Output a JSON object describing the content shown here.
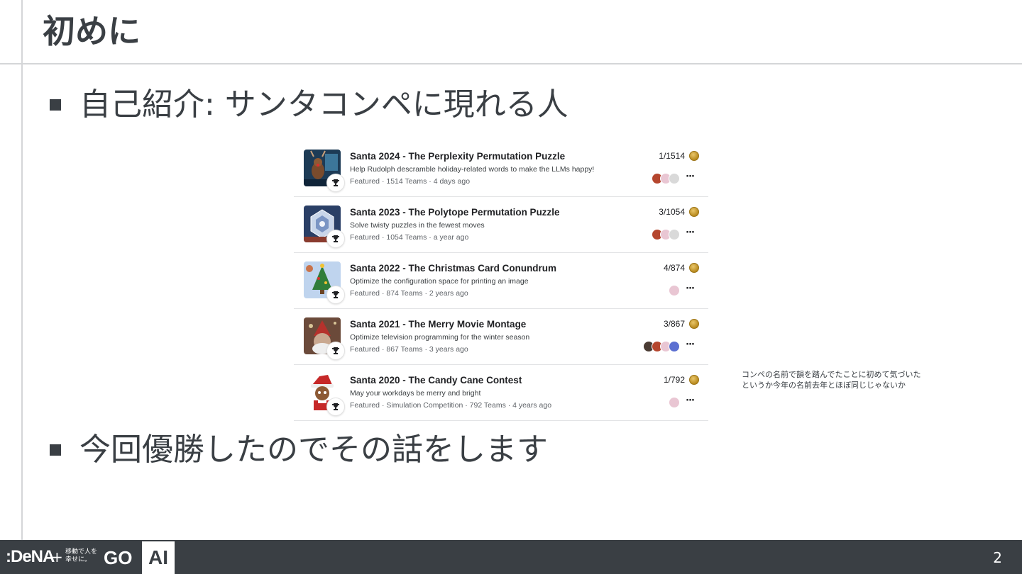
{
  "slide": {
    "title": "初めに",
    "bullets": [
      "自己紹介: サンタコンペに現れる人",
      "今回優勝したのでその話をします"
    ],
    "note_lines": [
      "コンペの名前で韻を踏んでたことに初めて気づいた",
      "というか今年の名前去年とほぼ同じじゃないか"
    ],
    "page_number": "2"
  },
  "footer": {
    "dena_logo": ":DeNA",
    "plus": "+",
    "go_tagline": "移動で人を幸せに。",
    "go_logo": "GO",
    "ai_logo": "AI"
  },
  "competitions": [
    {
      "title": "Santa 2024 - The Perplexity Permutation Puzzle",
      "description": "Help Rudolph descramble holiday-related words to make the LLMs happy!",
      "meta": "Featured · 1514 Teams · 4 days ago",
      "rank": "1/1514",
      "avatar_count": 3,
      "thumb_colors": [
        "#1d3b56",
        "#7a4b2c"
      ]
    },
    {
      "title": "Santa 2023 - The Polytope Permutation Puzzle",
      "description": "Solve twisty puzzles in the fewest moves",
      "meta": "Featured · 1054 Teams · a year ago",
      "rank": "3/1054",
      "avatar_count": 3,
      "thumb_colors": [
        "#2a3f66",
        "#c9d6ea"
      ]
    },
    {
      "title": "Santa 2022 - The Christmas Card Conundrum",
      "description": "Optimize the configuration space for printing an image",
      "meta": "Featured · 874 Teams · 2 years ago",
      "rank": "4/874",
      "avatar_count": 1,
      "thumb_colors": [
        "#bfd4ee",
        "#2f7d3a"
      ]
    },
    {
      "title": "Santa 2021 - The Merry Movie Montage",
      "description": "Optimize television programming for the winter season",
      "meta": "Featured · 867 Teams · 3 years ago",
      "rank": "3/867",
      "avatar_count": 4,
      "thumb_colors": [
        "#6b4a3a",
        "#c9a890"
      ]
    },
    {
      "title": "Santa 2020 - The Candy Cane Contest",
      "description": "May your workdays be merry and bright",
      "meta": "Featured · Simulation Competition · 792 Teams · 4 years ago",
      "rank": "1/792",
      "avatar_count": 1,
      "thumb_colors": [
        "#ffffff",
        "#c62828"
      ]
    }
  ],
  "colors": {
    "text_dark": "#3a3f44",
    "footer_bg": "#3a3f44",
    "medal_gold": "#c9a03a",
    "divider": "#d4d6d8"
  }
}
